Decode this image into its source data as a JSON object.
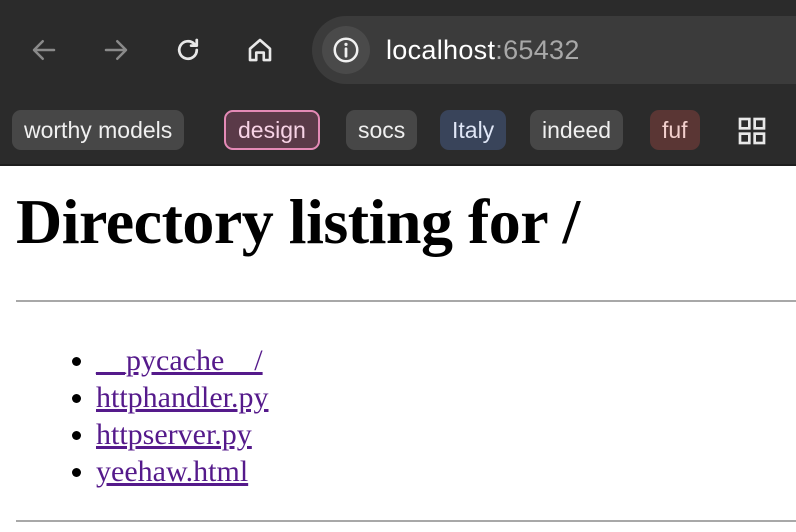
{
  "browser": {
    "url_host": "localhost",
    "url_port": ":65432",
    "bookmarks": [
      {
        "label": "worthy models"
      },
      {
        "label": "design"
      },
      {
        "label": "socs"
      },
      {
        "label": "Italy"
      },
      {
        "label": "indeed"
      },
      {
        "label": "fuf"
      }
    ],
    "icons": {
      "back": "arrow-left-icon",
      "forward": "arrow-right-icon",
      "reload": "reload-icon",
      "home": "home-icon",
      "site_info": "info-icon",
      "apps": "grid-icon"
    },
    "colors": {
      "chrome_bg": "#2b2b2b",
      "omnibox_bg": "#3b3b3b",
      "design_border": "#e48ab6",
      "link_visited": "#551a8b"
    }
  },
  "page": {
    "title": "Directory listing for /",
    "files": [
      {
        "name": "__pycache__/"
      },
      {
        "name": "httphandler.py"
      },
      {
        "name": "httpserver.py"
      },
      {
        "name": "yeehaw.html"
      }
    ]
  }
}
